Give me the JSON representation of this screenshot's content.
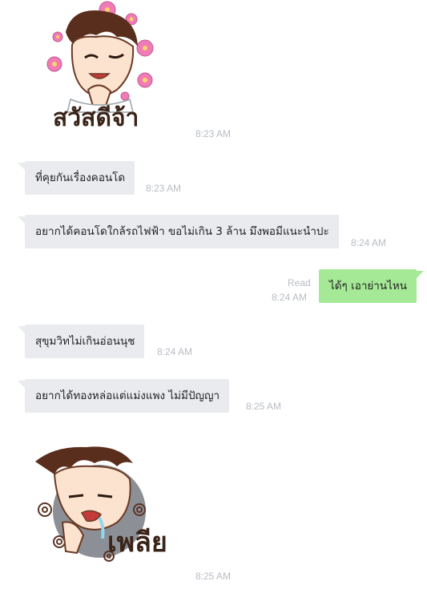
{
  "chat": {
    "messages": [
      {
        "type": "sticker",
        "sender": "them",
        "name": "sawasdee",
        "caption": "สวัสดีจ้า",
        "time": "8:23 AM"
      },
      {
        "type": "text",
        "sender": "them",
        "text": "ที่คุยกันเรื่องคอนโด",
        "time": "8:23 AM"
      },
      {
        "type": "text",
        "sender": "them",
        "text": "อยากได้คอนโดใกล้รถไฟฟ้า ขอไม่เกิน 3 ล้าน มึงพอมีแนะนำปะ",
        "time": "8:24 AM"
      },
      {
        "type": "text",
        "sender": "me",
        "text": "ได้ๆ เอาย่านไหน",
        "status": "Read",
        "time": "8:24 AM"
      },
      {
        "type": "text",
        "sender": "them",
        "text": "สุขุมวิทไม่เกินอ่อนนุช",
        "time": "8:24 AM"
      },
      {
        "type": "text",
        "sender": "them",
        "text": "อยากได้ทองหล่อแต่แม่งแพง ไม่มีปัญญา",
        "time": "8:25 AM"
      },
      {
        "type": "sticker",
        "sender": "them",
        "name": "plia",
        "caption": "เพลีย",
        "time": "8:25 AM"
      }
    ]
  },
  "colors": {
    "incoming_bubble": "#e9ebef",
    "outgoing_bubble": "#a5e996",
    "timestamp": "#b8bcc3",
    "flower": "#f07bb5"
  }
}
